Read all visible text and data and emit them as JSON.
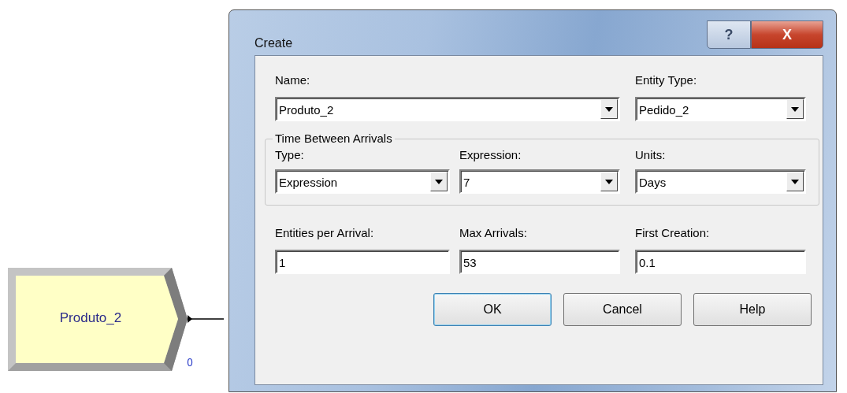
{
  "canvas": {
    "module": {
      "label": "Produto_2",
      "count": "0"
    }
  },
  "dialog": {
    "title": "Create",
    "help_glyph": "?",
    "close_glyph": "X",
    "fields": [
      {
        "label": "Name:",
        "kind": "combo",
        "value": "Produto_2"
      },
      {
        "label": "Entity Type:",
        "kind": "combo",
        "value": "Pedido_2"
      }
    ],
    "group": {
      "title": "Time Between Arrivals",
      "fields": [
        {
          "label": "Type:",
          "kind": "combo",
          "value": "Expression"
        },
        {
          "label": "Expression:",
          "kind": "combo",
          "value": "7"
        },
        {
          "label": "Units:",
          "kind": "combo",
          "value": "Days"
        }
      ]
    },
    "fields_2": [
      {
        "label": "Entities per Arrival:",
        "kind": "text",
        "value": "1"
      },
      {
        "label": "Max Arrivals:",
        "kind": "text",
        "value": "53"
      },
      {
        "label": "First Creation:",
        "kind": "text",
        "value": "0.1"
      }
    ],
    "buttons": [
      "OK",
      "Cancel",
      "Help"
    ]
  }
}
